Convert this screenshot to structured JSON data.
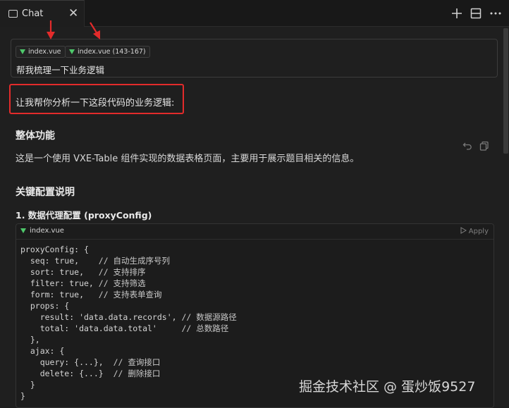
{
  "tab": {
    "label": "Chat",
    "close": "✕"
  },
  "toolbar": {
    "new_icon": "plus-icon",
    "layout_icon": "split-layout-icon",
    "more_icon": "ellipsis-icon"
  },
  "context": {
    "chips": [
      {
        "label": "index.vue"
      },
      {
        "label": "index.vue (143-167)"
      }
    ],
    "prompt": "帮我梳理一下业务逻辑"
  },
  "response": {
    "intro": "让我帮你分析一下这段代码的业务逻辑:",
    "section1_title": "整体功能",
    "section1_text": "这是一个使用 VXE-Table 组件实现的数据表格页面，主要用于展示题目相关的信息。",
    "section2_title": "关键配置说明",
    "item1_title": "1. 数据代理配置 (proxyConfig)",
    "code": {
      "filename": "index.vue",
      "apply_label": "Apply",
      "lines": [
        {
          "code": "proxyConfig: {",
          "comment": ""
        },
        {
          "code": "  seq: true,    ",
          "comment": "// 自动生成序号列"
        },
        {
          "code": "  sort: true,   ",
          "comment": "// 支持排序"
        },
        {
          "code": "  filter: true, ",
          "comment": "// 支持筛选"
        },
        {
          "code": "  form: true,   ",
          "comment": "// 支持表单查询"
        },
        {
          "code": "  props: {",
          "comment": ""
        },
        {
          "code": "    result: 'data.data.records', ",
          "comment": "// 数据源路径"
        },
        {
          "code": "    total: 'data.data.total'     ",
          "comment": "// 总数路径"
        },
        {
          "code": "  },",
          "comment": ""
        },
        {
          "code": "  ajax: {",
          "comment": ""
        },
        {
          "code": "    query: {...},  ",
          "comment": "// 查询接口"
        },
        {
          "code": "    delete: {...}  ",
          "comment": "// 删除接口"
        },
        {
          "code": "  }",
          "comment": ""
        },
        {
          "code": "}",
          "comment": ""
        }
      ]
    }
  },
  "watermark": "掘金技术社区 @ 蛋炒饭9527",
  "colors": {
    "highlight": "#e32b2b",
    "vue_green": "#4ec86b",
    "annotation_arrow": "#e32b2b"
  }
}
